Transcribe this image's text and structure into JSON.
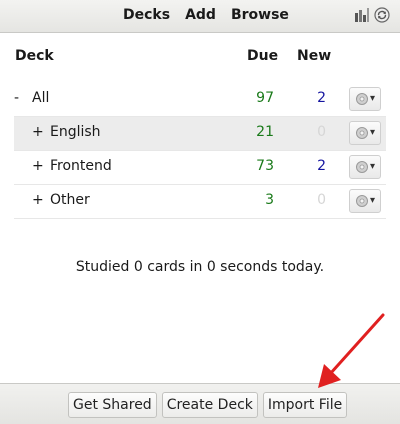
{
  "toolbar": {
    "nav": {
      "decks": "Decks",
      "add": "Add",
      "browse": "Browse"
    },
    "icons": [
      "stats-icon",
      "sync-icon"
    ]
  },
  "table": {
    "headers": {
      "deck": "Deck",
      "due": "Due",
      "new": "New"
    },
    "rows": [
      {
        "toggle": "-",
        "name": "All",
        "due": "97",
        "new": "2"
      },
      {
        "toggle": "+",
        "name": "English",
        "due": "21",
        "new": "0"
      },
      {
        "toggle": "+",
        "name": "Frontend",
        "due": "73",
        "new": "2"
      },
      {
        "toggle": "+",
        "name": "Other",
        "due": "3",
        "new": "0"
      }
    ]
  },
  "status": "Studied 0 cards in 0 seconds today.",
  "bottom": {
    "get_shared": "Get Shared",
    "create_deck": "Create Deck",
    "import_file": "Import File"
  },
  "colors": {
    "due": "#1a7a1a",
    "new": "#1515a0",
    "zero": "#d6d6d6",
    "annotation": "#e02020"
  }
}
